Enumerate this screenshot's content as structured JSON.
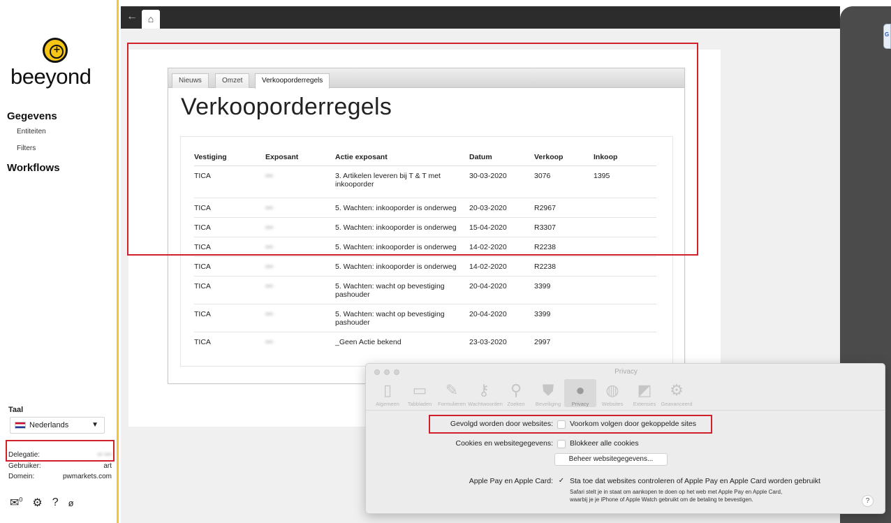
{
  "sidebar": {
    "logo": "beeyond",
    "nav": [
      {
        "label": "Gegevens",
        "items": [
          "Entiteiten",
          "Filters"
        ]
      },
      {
        "label": "Workflows"
      }
    ],
    "taal_label": "Taal",
    "language": "Nederlands",
    "delegatie_label": "Delegatie:",
    "delegatie_value": "•• •••",
    "gebruiker_label": "Gebruiker:",
    "gebruiker_value": "art",
    "domein_label": "Domein:",
    "domein_value": "pwmarkets.com",
    "mail_count": "0"
  },
  "topbar": {
    "back_icon": "←",
    "home_icon": "home-icon"
  },
  "tabs": [
    "Nieuws",
    "Omzet",
    "Verkooporderregels"
  ],
  "active_tab": "Verkooporderregels",
  "page_title": "Verkooporderregels",
  "table": {
    "headers": [
      "Vestiging",
      "Exposant",
      "Actie exposant",
      "Datum",
      "Verkoop",
      "Inkoop"
    ],
    "rows": [
      {
        "vestiging": "TICA",
        "exposant": "•••",
        "actie": "3. Artikelen leveren bij T & T met inkooporder",
        "datum": "30-03-2020",
        "verkoop": "3076",
        "inkoop": "1395"
      },
      {
        "vestiging": "TICA",
        "exposant": "•••",
        "actie": "5. Wachten: inkooporder is onderweg",
        "datum": "20-03-2020",
        "verkoop": "R2967",
        "inkoop": ""
      },
      {
        "vestiging": "TICA",
        "exposant": "•••",
        "actie": "5. Wachten: inkooporder is onderweg",
        "datum": "15-04-2020",
        "verkoop": "R3307",
        "inkoop": ""
      },
      {
        "vestiging": "TICA",
        "exposant": "•••",
        "actie": "5. Wachten: inkooporder is onderweg",
        "datum": "14-02-2020",
        "verkoop": "R2238",
        "inkoop": ""
      },
      {
        "vestiging": "TICA",
        "exposant": "•••",
        "actie": "5. Wachten: inkooporder is onderweg",
        "datum": "14-02-2020",
        "verkoop": "R2238",
        "inkoop": ""
      },
      {
        "vestiging": "TICA",
        "exposant": "•••",
        "actie": "5. Wachten: wacht op bevestiging pashouder",
        "datum": "20-04-2020",
        "verkoop": "3399",
        "inkoop": ""
      },
      {
        "vestiging": "TICA",
        "exposant": "•••",
        "actie": "5. Wachten: wacht op bevestiging pashouder",
        "datum": "20-04-2020",
        "verkoop": "3399",
        "inkoop": ""
      },
      {
        "vestiging": "TICA",
        "exposant": "•••",
        "actie": "_Geen Actie bekend",
        "datum": "23-03-2020",
        "verkoop": "2997",
        "inkoop": ""
      }
    ]
  },
  "prefs": {
    "title": "Privacy",
    "toolbar": [
      "Algemeen",
      "Tabbladen",
      "Formulieren",
      "Wachtwoorden",
      "Zoeken",
      "Beveiliging",
      "Privacy",
      "Websites",
      "Extensies",
      "Geavanceerd"
    ],
    "selected": "Privacy",
    "tracking_label": "Gevolgd worden door websites:",
    "tracking_option": "Voorkom volgen door gekoppelde sites",
    "cookies_label": "Cookies en websitegegevens:",
    "cookies_option": "Blokkeer alle cookies",
    "manage_button": "Beheer websitegegevens...",
    "applepay_label": "Apple Pay en Apple Card:",
    "applepay_option": "Sta toe dat websites controleren of Apple Pay en Apple Card worden gebruikt",
    "applepay_note_1": "Safari stelt je in staat om aankopen te doen op het web met Apple Pay en Apple Card,",
    "applepay_note_2": "waarbij je je iPhone of Apple Watch gebruikt om de betaling te bevestigen.",
    "help": "?"
  }
}
